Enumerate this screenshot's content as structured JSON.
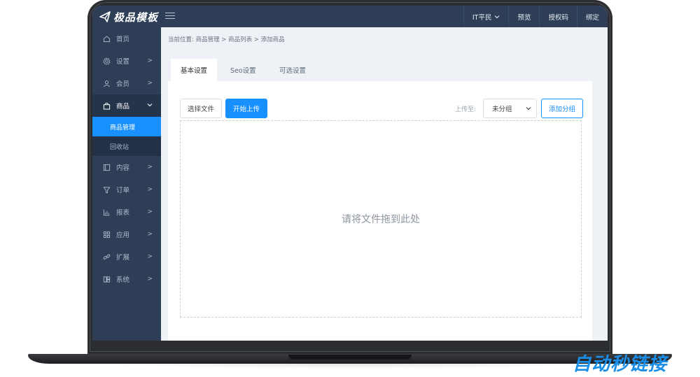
{
  "app": {
    "logo_text": "极品模板"
  },
  "topbar": {
    "user_label": "IT平民",
    "items": [
      "预览",
      "授权码",
      "绑定"
    ]
  },
  "sidebar": {
    "items": [
      {
        "label": "首页",
        "icon": "home-icon",
        "arrow": false
      },
      {
        "label": "设置",
        "icon": "gear-icon",
        "arrow": true
      },
      {
        "label": "会员",
        "icon": "user-icon",
        "arrow": true
      },
      {
        "label": "商品",
        "icon": "bag-icon",
        "arrow": true,
        "expanded": true
      },
      {
        "label": "内容",
        "icon": "document-icon",
        "arrow": true
      },
      {
        "label": "订单",
        "icon": "cup-icon",
        "arrow": true
      },
      {
        "label": "报表",
        "icon": "chart-icon",
        "arrow": true
      },
      {
        "label": "应用",
        "icon": "grid-icon",
        "arrow": true
      },
      {
        "label": "扩展",
        "icon": "link-icon",
        "arrow": true
      },
      {
        "label": "系统",
        "icon": "modules-icon",
        "arrow": true
      }
    ],
    "sub_items": [
      "商品管理",
      "回收站"
    ]
  },
  "breadcrumb": "当前位置: 商品管理 > 商品列表 > 添加商品",
  "tabs": [
    "基本设置",
    "Seo设置",
    "可选设置"
  ],
  "toolbar": {
    "choose_file": "选择文件",
    "start_upload": "开始上传",
    "upload_to_label": "上传至:",
    "group_selected": "未分组",
    "add_group": "添加分组"
  },
  "dropzone": {
    "text": "请将文件拖到此处"
  },
  "watermark": "自动秒链接",
  "colors": {
    "sidebar_bg": "#2d3e56",
    "accent": "#1890ff"
  }
}
